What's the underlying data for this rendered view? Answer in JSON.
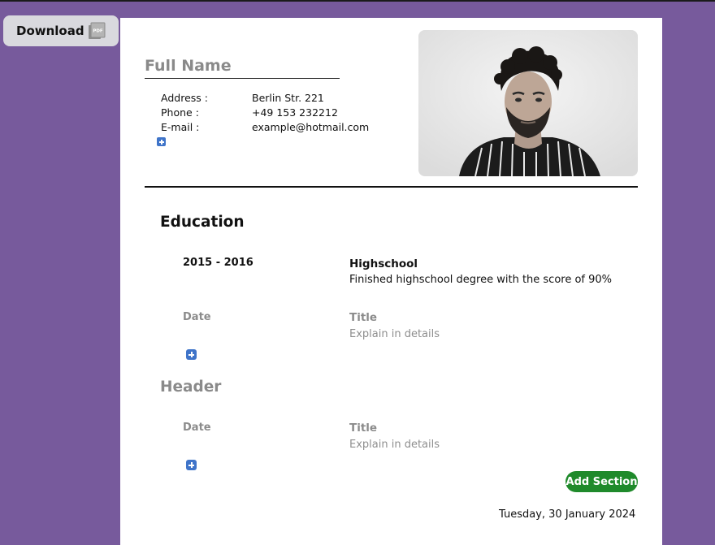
{
  "toolbar": {
    "download_label": "Download",
    "pdf_icon_text": "PDF"
  },
  "header": {
    "full_name_placeholder": "Full Name",
    "contact": [
      {
        "label": "Address :",
        "value": "Berlin Str. 221"
      },
      {
        "label": "Phone :",
        "value": "+49 153 232212"
      },
      {
        "label": "E-mail :",
        "value": "example@hotmail.com"
      }
    ]
  },
  "sections": [
    {
      "title": "Education",
      "entries": [
        {
          "date": "2015 - 2016",
          "title": "Highschool",
          "description": "Finished highschool degree with the score of 90%"
        },
        {
          "date": "Date",
          "title": "Title",
          "description": "Explain in details"
        }
      ]
    },
    {
      "title": "Header",
      "entries": [
        {
          "date": "Date",
          "title": "Title",
          "description": "Explain in details"
        }
      ]
    }
  ],
  "actions": {
    "add_section_label": "Add Section"
  },
  "footer": {
    "date": "Tuesday, 30 January 2024"
  },
  "colors": {
    "background": "#775a9c",
    "accent_blue": "#3f74c9",
    "add_section_green": "#1f8a2b"
  }
}
